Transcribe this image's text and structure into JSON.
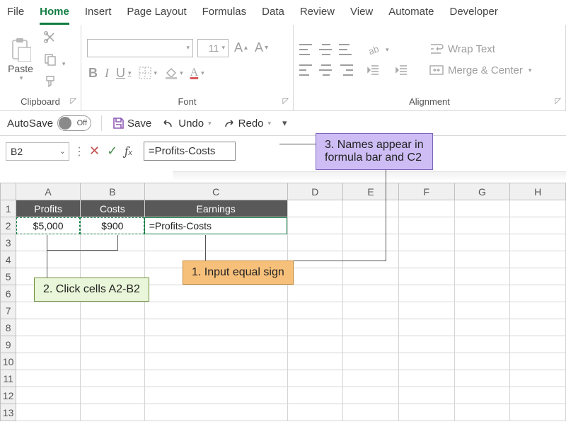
{
  "menu": {
    "file": "File",
    "home": "Home",
    "insert": "Insert",
    "page_layout": "Page Layout",
    "formulas": "Formulas",
    "data": "Data",
    "review": "Review",
    "view": "View",
    "automate": "Automate",
    "developer": "Developer"
  },
  "ribbon": {
    "clipboard": {
      "paste": "Paste",
      "label": "Clipboard"
    },
    "font": {
      "size": "11",
      "bold": "B",
      "italic": "I",
      "underline": "U",
      "label": "Font"
    },
    "alignment": {
      "wrap": "Wrap Text",
      "merge": "Merge & Center",
      "label": "Alignment"
    }
  },
  "qat": {
    "autosave": "AutoSave",
    "off": "Off",
    "save": "Save",
    "undo": "Undo",
    "redo": "Redo"
  },
  "formula_bar": {
    "name_box": "B2",
    "formula": "=Profits-Costs"
  },
  "sheet": {
    "columns": [
      "A",
      "B",
      "C",
      "D",
      "E",
      "F",
      "G",
      "H"
    ],
    "rows": [
      "1",
      "2",
      "3",
      "4",
      "5",
      "6",
      "7",
      "8",
      "9",
      "10",
      "11",
      "12",
      "13"
    ],
    "headers": {
      "a1": "Profits",
      "b1": "Costs",
      "c1": "Earnings"
    },
    "data": {
      "a2": "$5,000",
      "b2": "$900",
      "c2": "=Profits-Costs"
    }
  },
  "callouts": {
    "step1": "1. Input equal sign",
    "step2": "2. Click cells A2-B2",
    "step3": "3. Names appear in\nformula bar and C2"
  }
}
